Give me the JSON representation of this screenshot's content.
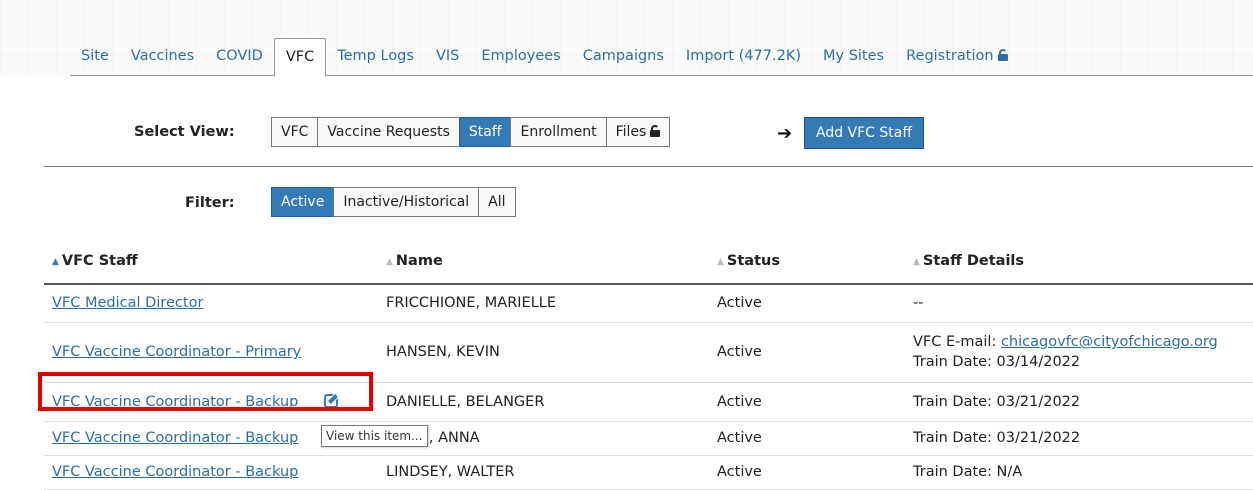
{
  "tabs": [
    {
      "label": "Site"
    },
    {
      "label": "Vaccines"
    },
    {
      "label": "COVID"
    },
    {
      "label": "VFC",
      "active": true
    },
    {
      "label": "Temp Logs"
    },
    {
      "label": "VIS"
    },
    {
      "label": "Employees"
    },
    {
      "label": "Campaigns"
    },
    {
      "label": "Import (477.2K)"
    },
    {
      "label": "My Sites"
    },
    {
      "label": "Registration",
      "locked": true
    }
  ],
  "select_view": {
    "label": "Select View:",
    "options": [
      "VFC",
      "Vaccine Requests",
      "Staff",
      "Enrollment",
      "Files"
    ],
    "selected": "Staff",
    "locked_option": "Files"
  },
  "add_button": {
    "label": "Add VFC Staff"
  },
  "filter": {
    "label": "Filter:",
    "options": [
      "Active",
      "Inactive/Historical",
      "All"
    ],
    "selected": "Active"
  },
  "table": {
    "headers": [
      "VFC Staff",
      "Name",
      "Status",
      "Staff Details"
    ],
    "rows": [
      {
        "role": "VFC Medical Director",
        "name": "FRICCHIONE, MARIELLE",
        "status": "Active",
        "details_prefix": "--",
        "details_link": "",
        "train": ""
      },
      {
        "role": "VFC Vaccine Coordinator - Primary",
        "name": "HANSEN, KEVIN",
        "status": "Active",
        "details_prefix": "VFC E-mail: ",
        "details_link": "chicagovfc@cityofchicago.org",
        "train": "Train Date: 03/14/2022"
      },
      {
        "role": "VFC Vaccine Coordinator - Backup",
        "name": "DANIELLE, BELANGER",
        "status": "Active",
        "details_prefix": "",
        "details_link": "",
        "train": "Train Date: 03/21/2022"
      },
      {
        "role": "VFC Vaccine Coordinator - Backup",
        "name": "N, ANNA",
        "status": "Active",
        "details_prefix": "",
        "details_link": "",
        "train": "Train Date: 03/21/2022"
      },
      {
        "role": "VFC Vaccine Coordinator - Backup",
        "name": "LINDSEY, WALTER",
        "status": "Active",
        "details_prefix": "",
        "details_link": "",
        "train": "Train Date: N/A"
      }
    ]
  },
  "tooltip": {
    "text": "View this item..."
  },
  "colors": {
    "accent": "#337ab7",
    "link": "#2e6da4",
    "highlight": "#e10000"
  },
  "icons": {
    "edit": "edit-square-icon",
    "lock": "lock-icon",
    "arrow": "arrow-right-icon",
    "sort": "sort-caret-icon"
  }
}
